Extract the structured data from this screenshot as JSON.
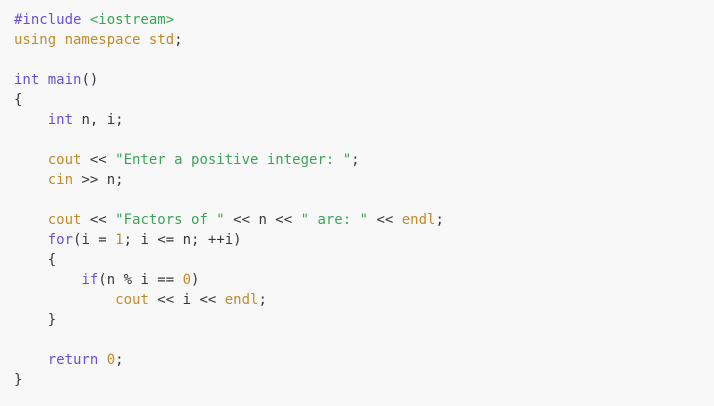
{
  "editor": {
    "background": "#f8f8f8",
    "colors": {
      "preprocessor": "#6a4fd1",
      "string": "#3aa655",
      "keyword": "#6a4fd1",
      "identifier": "#c18a2a",
      "number": "#c18a2a",
      "plain": "#34383c"
    },
    "lines": [
      [
        {
          "t": "#include ",
          "k": "pre"
        },
        {
          "t": "<iostream>",
          "k": "str"
        }
      ],
      [
        {
          "t": "using ",
          "k": "id"
        },
        {
          "t": "namespace ",
          "k": "id"
        },
        {
          "t": "std",
          "k": "id"
        },
        {
          "t": ";",
          "k": "op"
        }
      ],
      [],
      [
        {
          "t": "int ",
          "k": "ty"
        },
        {
          "t": "main",
          "k": "fn"
        },
        {
          "t": "()",
          "k": "op"
        }
      ],
      [
        {
          "t": "{",
          "k": "op"
        }
      ],
      [
        {
          "t": "    ",
          "k": "op"
        },
        {
          "t": "int ",
          "k": "ty"
        },
        {
          "t": "n, i;",
          "k": "op"
        }
      ],
      [],
      [
        {
          "t": "    ",
          "k": "op"
        },
        {
          "t": "cout",
          "k": "id"
        },
        {
          "t": " << ",
          "k": "op"
        },
        {
          "t": "\"Enter a positive integer: \"",
          "k": "str"
        },
        {
          "t": ";",
          "k": "op"
        }
      ],
      [
        {
          "t": "    ",
          "k": "op"
        },
        {
          "t": "cin",
          "k": "id"
        },
        {
          "t": " >> n;",
          "k": "op"
        }
      ],
      [],
      [
        {
          "t": "    ",
          "k": "op"
        },
        {
          "t": "cout",
          "k": "id"
        },
        {
          "t": " << ",
          "k": "op"
        },
        {
          "t": "\"Factors of \"",
          "k": "str"
        },
        {
          "t": " << n << ",
          "k": "op"
        },
        {
          "t": "\" are: \"",
          "k": "str"
        },
        {
          "t": " << ",
          "k": "op"
        },
        {
          "t": "endl",
          "k": "id"
        },
        {
          "t": ";",
          "k": "op"
        }
      ],
      [
        {
          "t": "    ",
          "k": "op"
        },
        {
          "t": "for",
          "k": "kw"
        },
        {
          "t": "(i = ",
          "k": "op"
        },
        {
          "t": "1",
          "k": "num"
        },
        {
          "t": "; i <= n; ++i)",
          "k": "op"
        }
      ],
      [
        {
          "t": "    {",
          "k": "op"
        }
      ],
      [
        {
          "t": "        ",
          "k": "op"
        },
        {
          "t": "if",
          "k": "kw"
        },
        {
          "t": "(n % i == ",
          "k": "op"
        },
        {
          "t": "0",
          "k": "num"
        },
        {
          "t": ")",
          "k": "op"
        }
      ],
      [
        {
          "t": "            ",
          "k": "op"
        },
        {
          "t": "cout",
          "k": "id"
        },
        {
          "t": " << i << ",
          "k": "op"
        },
        {
          "t": "endl",
          "k": "id"
        },
        {
          "t": ";",
          "k": "op"
        }
      ],
      [
        {
          "t": "    }",
          "k": "op"
        }
      ],
      [],
      [
        {
          "t": "    ",
          "k": "op"
        },
        {
          "t": "return ",
          "k": "kw"
        },
        {
          "t": "0",
          "k": "num"
        },
        {
          "t": ";",
          "k": "op"
        }
      ],
      [
        {
          "t": "}",
          "k": "op"
        }
      ]
    ]
  }
}
